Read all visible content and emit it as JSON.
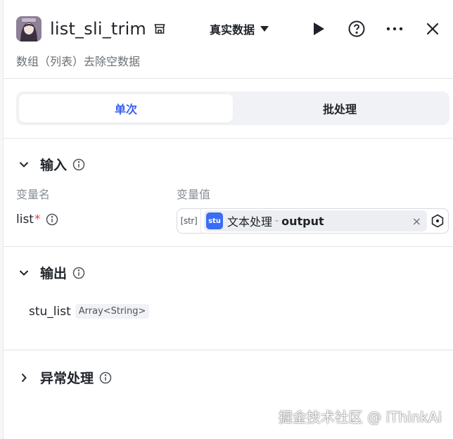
{
  "header": {
    "title": "list_sli_trim",
    "subtitle": "数组（列表）去除空数据",
    "data_mode": "真实数据",
    "icons": {
      "title_icon": "storefront-icon",
      "run": "play-icon",
      "help": "help-circle-icon",
      "more": "more-horizontal-icon",
      "close": "close-icon"
    }
  },
  "tabs": [
    {
      "label": "单次",
      "active": true
    },
    {
      "label": "批处理",
      "active": false
    }
  ],
  "input_section": {
    "title": "输入",
    "columns": {
      "name": "变量名",
      "value": "变量值"
    },
    "variables": [
      {
        "name": "list",
        "required_mark": "*",
        "type_tag": "[str]",
        "node_icon_text": "stu",
        "node_name": "文本处理",
        "separator": "-",
        "output": "output",
        "clear": "×"
      }
    ]
  },
  "output_section": {
    "title": "输出",
    "fields": [
      {
        "name": "stu_list",
        "type": "Array<String>"
      }
    ]
  },
  "exception_section": {
    "title": "异常处理"
  },
  "watermark": "掘金技术社区 @ iThinkAi",
  "colors": {
    "accent": "#3b5cf5",
    "required": "#f2394a",
    "node_icon_bg": "#3b6cf5"
  }
}
